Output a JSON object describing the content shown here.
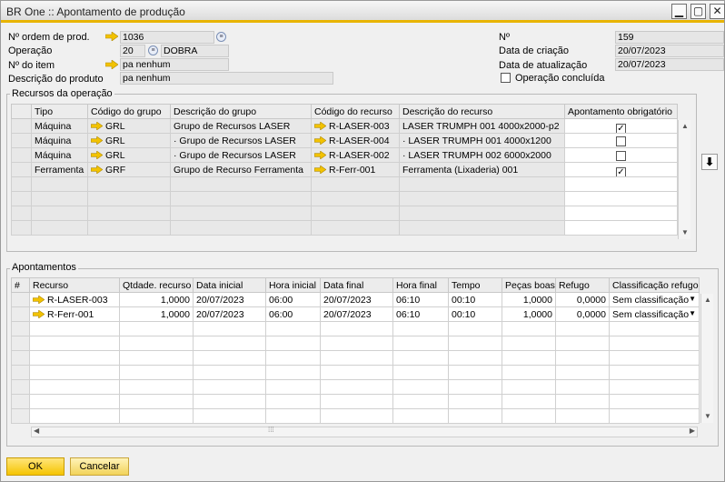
{
  "window": {
    "title": "BR One :: Apontamento de produção",
    "btn_min": "▁",
    "btn_max": "▢",
    "btn_close": "✕"
  },
  "header": {
    "ordem_label": "Nº ordem de prod.",
    "ordem_value": "1036",
    "operacao_label": "Operação",
    "operacao_code": "20",
    "operacao_name": "DOBRA",
    "item_label": "Nº do item",
    "item_value": "pa nenhum",
    "produto_label": "Descrição do produto",
    "produto_value": "pa nenhum",
    "numero_label": "Nº",
    "numero_value": "159",
    "criacao_label": "Data de criação",
    "criacao_value": "20/07/2023",
    "atualizacao_label": "Data de atualização",
    "atualizacao_value": "20/07/2023",
    "concluida_label": "Operação concluída"
  },
  "recursos": {
    "title": "Recursos da operação",
    "columns": [
      "Tipo",
      "Código do grupo",
      "Descrição do grupo",
      "Código do recurso",
      "Descrição do recurso",
      "Apontamento obrigatório"
    ],
    "rows": [
      {
        "tipo": "Máquina",
        "cod_grupo": "GRL",
        "desc_grupo": "Grupo de Recursos LASER",
        "cod_recurso": "R-LASER-003",
        "desc_recurso": "LASER TRUMPH 001 4000x2000-p2",
        "obrigatorio": true
      },
      {
        "tipo": "Máquina",
        "cod_grupo": "GRL",
        "desc_grupo": "·        Grupo de Recursos LASER",
        "cod_recurso": "R-LASER-004",
        "desc_recurso": "·        LASER TRUMPH 001 4000x1200",
        "obrigatorio": false
      },
      {
        "tipo": "Máquina",
        "cod_grupo": "GRL",
        "desc_grupo": "·        Grupo de Recursos LASER",
        "cod_recurso": "R-LASER-002",
        "desc_recurso": "·        LASER TRUMPH 002 6000x2000",
        "obrigatorio": false
      },
      {
        "tipo": "Ferramenta",
        "cod_grupo": "GRF",
        "desc_grupo": "Grupo de Recurso Ferramenta",
        "cod_recurso": "R-Ferr-001",
        "desc_recurso": "Ferramenta (Lixaderia) 001",
        "obrigatorio": true
      }
    ]
  },
  "apontamentos": {
    "title": "Apontamentos",
    "columns": [
      "#",
      "Recurso",
      "Qtdade. recurso",
      "Data inicial",
      "Hora inicial",
      "Data final",
      "Hora final",
      "Tempo",
      "Peças boas",
      "Refugo",
      "Classificação refugo"
    ],
    "rows": [
      {
        "recurso": "R-LASER-003",
        "qtd": "1,0000",
        "data_ini": "20/07/2023",
        "hora_ini": "06:00",
        "data_fim": "20/07/2023",
        "hora_fim": "06:10",
        "tempo": "00:10",
        "pecas": "1,0000",
        "refugo": "0,0000",
        "classif": "Sem classificação"
      },
      {
        "recurso": "R-Ferr-001",
        "qtd": "1,0000",
        "data_ini": "20/07/2023",
        "hora_ini": "06:00",
        "data_fim": "20/07/2023",
        "hora_fim": "06:10",
        "tempo": "00:10",
        "pecas": "1,0000",
        "refugo": "0,0000",
        "classif": "Sem classificação"
      }
    ]
  },
  "buttons": {
    "ok": "OK",
    "cancel": "Cancelar"
  },
  "colors": {
    "accent": "#e8b400",
    "button": "#f5c400"
  }
}
